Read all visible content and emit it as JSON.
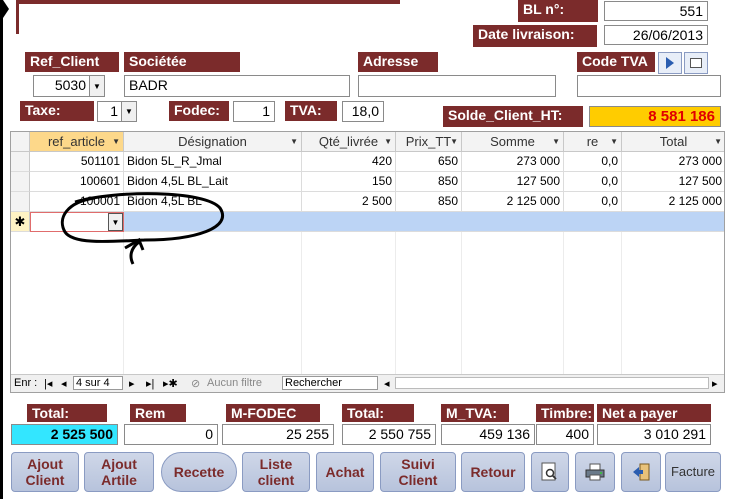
{
  "header": {
    "bl_label": "BL n°:",
    "bl_value": "551",
    "date_label": "Date livraison:",
    "date_value": "26/06/2013"
  },
  "client": {
    "ref_label": "Ref_Client",
    "ref_value": "5030",
    "societe_label": "Sociétée",
    "societe_value": "BADR",
    "adresse_label": "Adresse",
    "adresse_value": "",
    "code_tva_label": "Code TVA",
    "code_tva_value": ""
  },
  "tax": {
    "taxe_label": "Taxe:",
    "taxe_value": "1",
    "fodec_label": "Fodec:",
    "fodec_value": "1",
    "tva_label": "TVA:",
    "tva_value": "18,0",
    "solde_label": "Solde_Client_HT:",
    "solde_value": "8 581 186"
  },
  "grid": {
    "columns": [
      "ref_article",
      "Désignation",
      "Qté_livrée",
      "Prix_TT",
      "Somme",
      "re",
      "Total"
    ],
    "rows": [
      {
        "ref": "501101",
        "designation": "Bidon 5L_R_Jmal",
        "qte": "420",
        "prix": "650",
        "somme": "273 000",
        "re": "0,0",
        "total": "273 000"
      },
      {
        "ref": "100601",
        "designation": "Bidon 4,5L BL_Lait",
        "qte": "150",
        "prix": "850",
        "somme": "127 500",
        "re": "0,0",
        "total": "127 500"
      },
      {
        "ref": "100001",
        "designation": "Bidon 4,5L BL",
        "qte": "2 500",
        "prix": "850",
        "somme": "2 125 000",
        "re": "0,0",
        "total": "2 125 000"
      }
    ],
    "new_row_marker": "✱"
  },
  "navigation": {
    "enr_label": "Enr :",
    "record_text": "4 sur 4",
    "filter_text": "Aucun filtre",
    "search_text": "Rechercher"
  },
  "totals": {
    "total_label": "Total:",
    "total_value": "2 525 500",
    "rem_label": "Rem",
    "rem_value": "0",
    "mfodec_label": "M-FODEC",
    "mfodec_value": "25 255",
    "total2_label": "Total:",
    "total2_value": "2 550 755",
    "mtva_label": "M_TVA:",
    "mtva_value": "459 136",
    "timbre_label": "Timbre:",
    "timbre_value": "400",
    "net_label": "Net a payer",
    "net_value": "3 010 291"
  },
  "buttons": {
    "ajout_client": "Ajout Client",
    "ajout_article": "Ajout Artile",
    "recette": "Recette",
    "liste_client": "Liste client",
    "achat": "Achat",
    "suivi_client": "Suivi Client",
    "retour": "Retour",
    "facture": "Facture"
  },
  "colors": {
    "label_bg": "#7b2b2b",
    "solde_bg": "#ffcc00",
    "solde_text": "#e00000",
    "total_cyan": "#33e6ff",
    "new_row": "#bcd4f5"
  }
}
